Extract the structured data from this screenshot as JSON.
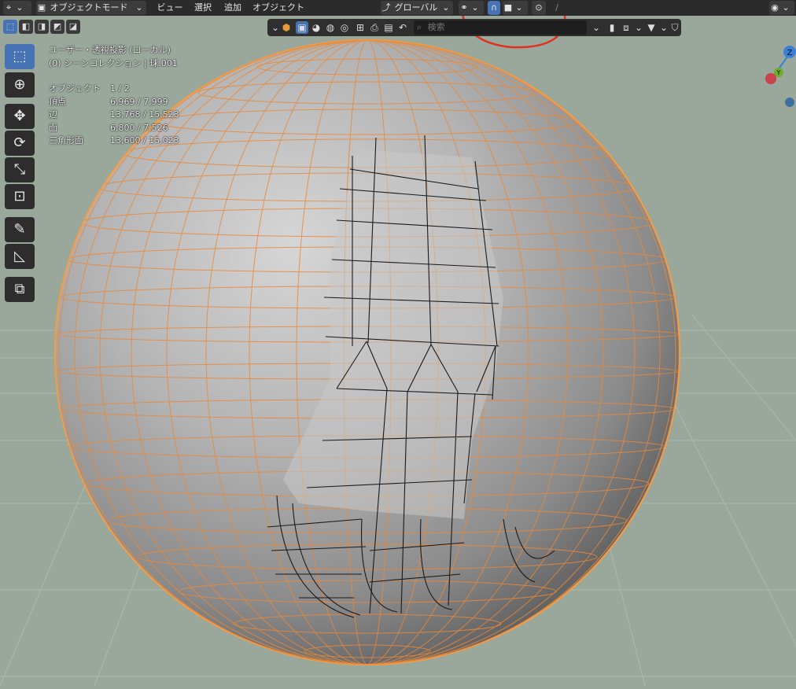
{
  "header": {
    "mode_label": "オブジェクトモード",
    "menus": [
      "ビュー",
      "選択",
      "追加",
      "オブジェクト"
    ],
    "transform_orientation": "グローバル"
  },
  "toolbar": {
    "search_placeholder": "検索"
  },
  "viewport_info": {
    "view_name": "ユーザー・透視投影 (ローカル)",
    "collection": "(0) シーンコレクション | 球.001",
    "stats": [
      {
        "label": "オブジェクト",
        "value": "1 / 2"
      },
      {
        "label": "頂点",
        "value": "6,969 / 7,999"
      },
      {
        "label": "辺",
        "value": "13,768 / 15,523"
      },
      {
        "label": "面",
        "value": "6,800 / 7,526"
      },
      {
        "label": "三角形面",
        "value": "13,600 / 15,023"
      }
    ]
  },
  "gizmo": {
    "z_label": "Z",
    "y_label": "Y"
  },
  "colors": {
    "selection_outline": "#ff9a3c",
    "active_tool": "#4772b3",
    "annotation_red": "#e0301e",
    "viewport_bg": "#9aa89c"
  }
}
